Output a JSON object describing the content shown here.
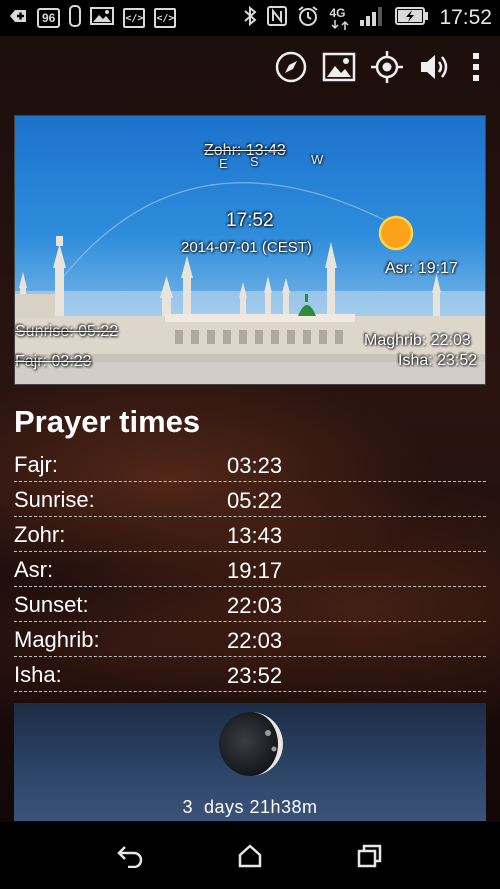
{
  "status_bar": {
    "battery_percent": "96",
    "network_label": "4G",
    "time": "17:52",
    "icons": [
      "add-icon",
      "battery-percent-icon",
      "phone-icon",
      "gallery-icon",
      "code-icon",
      "code-icon",
      "bluetooth-icon",
      "nfc-icon",
      "alarm-icon",
      "network-4g-icon",
      "signal-icon",
      "battery-charging-icon"
    ],
    "code_badge_text": "</>"
  },
  "action_bar": {
    "icons": [
      "compass-icon",
      "image-icon",
      "location-icon",
      "volume-icon",
      "overflow-menu-icon"
    ]
  },
  "sky": {
    "zohr": "Zohr: 13:43",
    "directions": [
      "E",
      "S",
      "W"
    ],
    "time": "17:52",
    "date": "2014-07-01 (CEST)",
    "asr": "Asr: 19:17",
    "sunrise": "Sunrise: 05:22",
    "fajr": "Fajr: 03:23",
    "maghrib": "Maghrib: 22:03",
    "isha": "Isha: 23:52",
    "colors": {
      "sun": "#f9a21a",
      "sky_top": "#1c72cc",
      "dome": "#2e8b3c"
    }
  },
  "prayer_times": {
    "heading": "Prayer times",
    "rows": [
      {
        "name": "Fajr:",
        "time": "03:23"
      },
      {
        "name": "Sunrise:",
        "time": "05:22"
      },
      {
        "name": "Zohr:",
        "time": "13:43"
      },
      {
        "name": "Asr:",
        "time": "19:17"
      },
      {
        "name": "Sunset:",
        "time": "22:03"
      },
      {
        "name": "Maghrib:",
        "time": "22:03"
      },
      {
        "name": "Isha:",
        "time": "23:52"
      }
    ]
  },
  "moon": {
    "countdown": "3  days 21h38m",
    "phase_icon": "waning-crescent-moon-icon"
  },
  "nav_bar": {
    "icons": [
      "back-icon",
      "home-icon",
      "recent-apps-icon"
    ]
  }
}
